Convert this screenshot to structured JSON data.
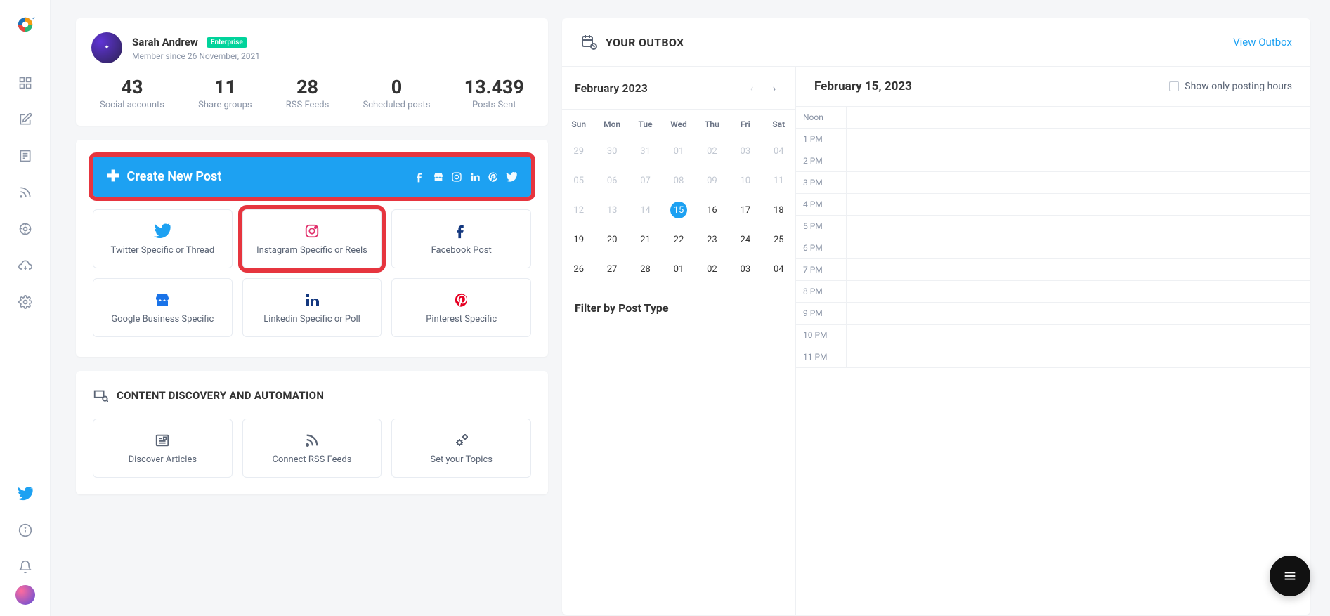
{
  "profile": {
    "name": "Sarah Andrew",
    "badge": "Enterprise",
    "member_since": "Member since 26 November, 2021"
  },
  "stats": [
    {
      "value": "43",
      "label": "Social accounts"
    },
    {
      "value": "11",
      "label": "Share groups"
    },
    {
      "value": "28",
      "label": "RSS Feeds"
    },
    {
      "value": "0",
      "label": "Scheduled posts"
    },
    {
      "value": "13.439",
      "label": "Posts Sent"
    }
  ],
  "create": {
    "button_label": "Create New Post",
    "tiles": [
      {
        "label": "Twitter Specific or Thread",
        "icon": "twitter",
        "color": "#1da1f2"
      },
      {
        "label": "Instagram Specific or Reels",
        "icon": "instagram",
        "color": "#e1306c",
        "highlight": true
      },
      {
        "label": "Facebook Post",
        "icon": "facebook",
        "color": "#14387f"
      },
      {
        "label": "Google Business Specific",
        "icon": "google-business",
        "color": "#1a73e8"
      },
      {
        "label": "Linkedin Specific or Poll",
        "icon": "linkedin",
        "color": "#14387f"
      },
      {
        "label": "Pinterest Specific",
        "icon": "pinterest",
        "color": "#e60023"
      }
    ]
  },
  "discovery": {
    "title": "CONTENT DISCOVERY AND AUTOMATION",
    "tiles": [
      {
        "label": "Discover Articles",
        "icon": "article"
      },
      {
        "label": "Connect RSS Feeds",
        "icon": "rss"
      },
      {
        "label": "Set your Topics",
        "icon": "gears"
      }
    ]
  },
  "outbox": {
    "title": "YOUR OUTBOX",
    "view_link": "View Outbox",
    "calendar": {
      "month_label": "February 2023",
      "dow": [
        "Sun",
        "Mon",
        "Tue",
        "Wed",
        "Thu",
        "Fri",
        "Sat"
      ],
      "weeks": [
        [
          {
            "d": "29",
            "out": true
          },
          {
            "d": "30",
            "out": true
          },
          {
            "d": "31",
            "out": true
          },
          {
            "d": "01",
            "out": true
          },
          {
            "d": "02",
            "out": true
          },
          {
            "d": "03",
            "out": true
          },
          {
            "d": "04",
            "out": true
          }
        ],
        [
          {
            "d": "05",
            "out": true
          },
          {
            "d": "06",
            "out": true
          },
          {
            "d": "07",
            "out": true
          },
          {
            "d": "08",
            "out": true
          },
          {
            "d": "09",
            "out": true
          },
          {
            "d": "10",
            "out": true
          },
          {
            "d": "11",
            "out": true
          }
        ],
        [
          {
            "d": "12",
            "out": true
          },
          {
            "d": "13",
            "out": true
          },
          {
            "d": "14",
            "out": true
          },
          {
            "d": "15",
            "sel": true
          },
          {
            "d": "16"
          },
          {
            "d": "17"
          },
          {
            "d": "18"
          }
        ],
        [
          {
            "d": "19"
          },
          {
            "d": "20"
          },
          {
            "d": "21"
          },
          {
            "d": "22"
          },
          {
            "d": "23"
          },
          {
            "d": "24"
          },
          {
            "d": "25"
          }
        ],
        [
          {
            "d": "26"
          },
          {
            "d": "27"
          },
          {
            "d": "28"
          },
          {
            "d": "01"
          },
          {
            "d": "02"
          },
          {
            "d": "03"
          },
          {
            "d": "04"
          }
        ]
      ]
    },
    "filter_title": "Filter by Post Type",
    "schedule": {
      "date_label": "February 15, 2023",
      "show_posting_label": "Show only posting hours",
      "hours": [
        "Noon",
        "1 PM",
        "2 PM",
        "3 PM",
        "4 PM",
        "5 PM",
        "6 PM",
        "7 PM",
        "8 PM",
        "9 PM",
        "10 PM",
        "11 PM"
      ]
    }
  }
}
